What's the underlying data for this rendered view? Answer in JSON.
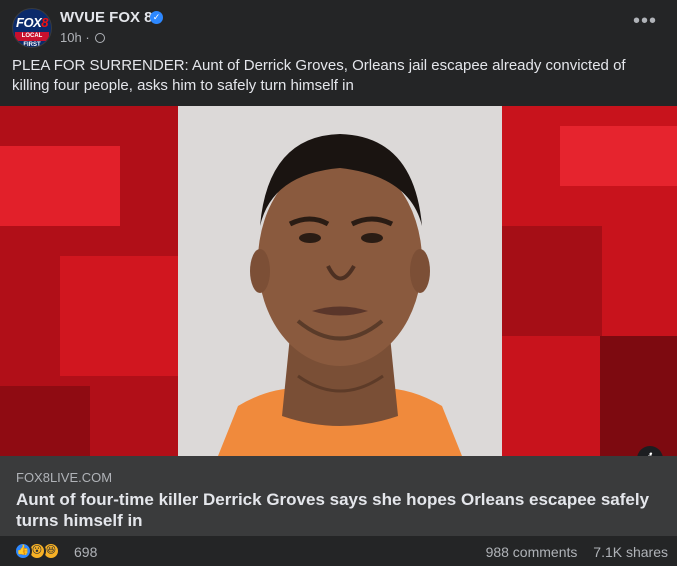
{
  "post": {
    "page_name": "WVUE FOX 8",
    "timestamp": "10h",
    "avatar": {
      "logo_top": "FOX 8",
      "logo_bottom": "LOCAL FIRST"
    },
    "text": "PLEA FOR SURRENDER: Aunt of Derrick Groves, Orleans jail escapee already convicted of killing four people, asks him to safely turn himself in"
  },
  "link_preview": {
    "domain": "FOX8LIVE.COM",
    "headline": "Aunt of four-time killer Derrick Groves says she hopes Orleans escapee safely turns himself in",
    "info_icon": "i"
  },
  "footer": {
    "reaction_count": "698",
    "comments": "988 comments",
    "shares": "7.1K shares",
    "reaction_icons": [
      "like-icon",
      "wow-icon",
      "haha-icon"
    ]
  },
  "colors": {
    "card_bg": "#242526",
    "link_bg": "#3a3b3c",
    "accent_blue": "#2d88ff",
    "image_red": "#c4121c",
    "prison_orange": "#f08a3c"
  }
}
